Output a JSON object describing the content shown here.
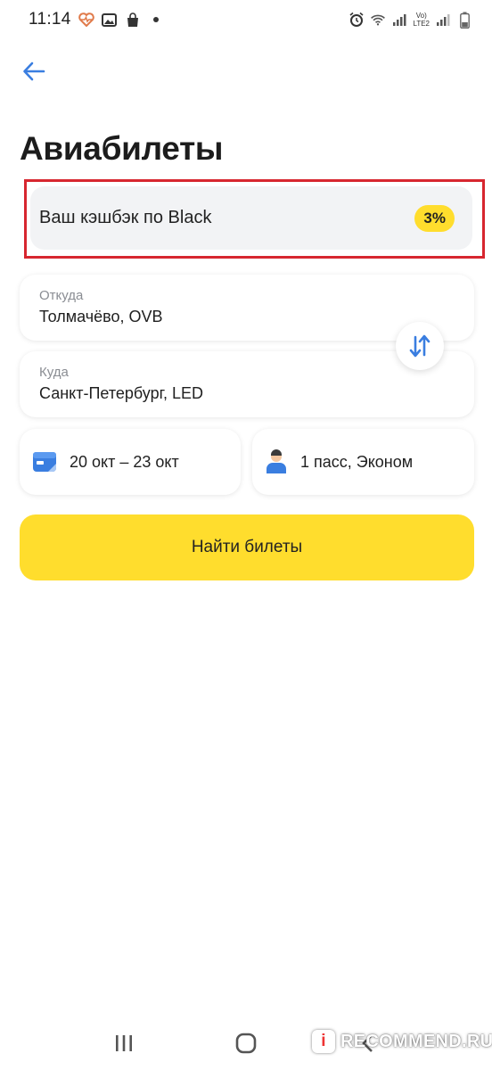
{
  "status_bar": {
    "time": "11:14",
    "network_line1": "Vo)",
    "network_line2": "LTE2",
    "icons": [
      "health-icon",
      "gallery-icon",
      "shopping-bag-icon",
      "dot-icon",
      "alarm-icon",
      "wifi-icon",
      "signal-icon",
      "battery-icon"
    ]
  },
  "header": {
    "back_icon": "arrow-left-icon",
    "title": "Авиабилеты"
  },
  "cashback": {
    "label": "Ваш кэшбэк по Black",
    "badge": "3%"
  },
  "form": {
    "from": {
      "label": "Откуда",
      "value": "Толмачёво, OVB"
    },
    "to": {
      "label": "Куда",
      "value": "Санкт-Петербург, LED"
    },
    "swap_icon": "swap-arrows-icon",
    "dates": {
      "icon": "calendar-icon",
      "value": "20 окт – 23 окт"
    },
    "passengers": {
      "icon": "person-icon",
      "value": "1 пасс, Эконом"
    },
    "search_button": "Найти билеты"
  },
  "nav": {
    "items": [
      "recents-icon",
      "home-icon",
      "back-icon"
    ]
  },
  "watermark": {
    "text": "RECOMMEND.RU",
    "logo_letter": "i"
  },
  "colors": {
    "accent_yellow": "#ffdd2d",
    "highlight_red": "#d7262f",
    "icon_blue": "#3a7ee0"
  }
}
